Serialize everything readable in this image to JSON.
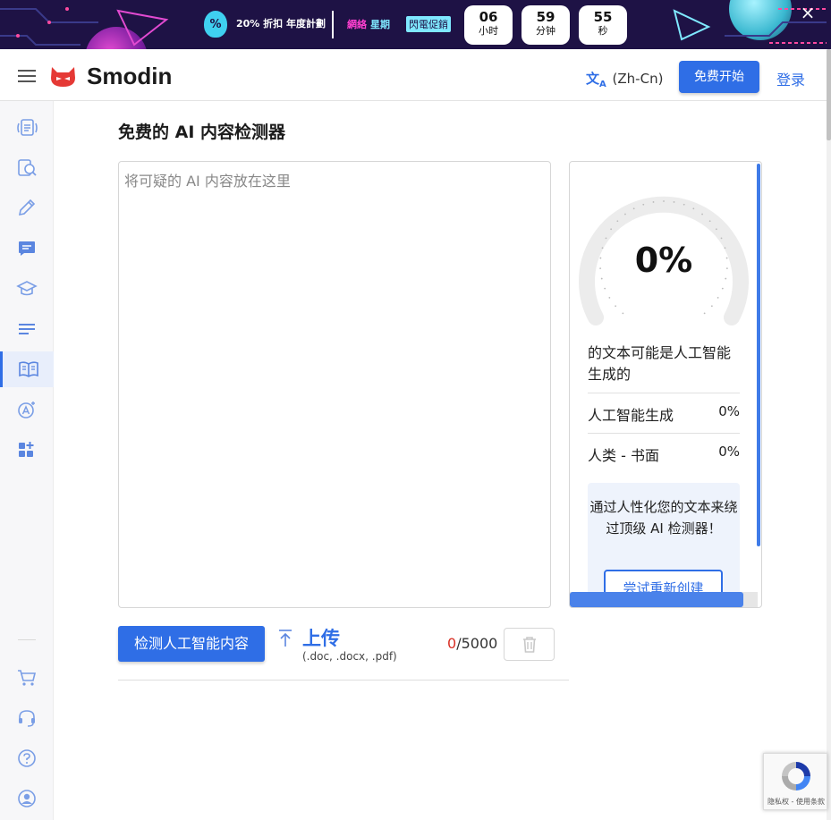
{
  "promo": {
    "offer": "20% 折扣 年度計劃",
    "cyber": "網絡",
    "week": "星期",
    "flash": "閃電促銷",
    "timers": [
      {
        "value": "06",
        "unit": "小时"
      },
      {
        "value": "59",
        "unit": "分钟"
      },
      {
        "value": "55",
        "unit": "秒"
      }
    ],
    "close_icon": "×"
  },
  "header": {
    "brand": "Smodin",
    "language": "(Zh-Cn)",
    "start_label": "免费开始",
    "login_label": "登录"
  },
  "sidebar": {
    "items": [
      {
        "name": "rewriter",
        "icon": "documents-icon"
      },
      {
        "name": "plagiarism",
        "icon": "search-doc-icon"
      },
      {
        "name": "writer",
        "icon": "pencil-icon"
      },
      {
        "name": "chat",
        "icon": "chat-icon"
      },
      {
        "name": "homework",
        "icon": "graduation-cap-icon"
      },
      {
        "name": "summarizer",
        "icon": "lines-icon"
      },
      {
        "name": "ai-detector",
        "icon": "book-icon",
        "active": true
      },
      {
        "name": "grader",
        "icon": "grade-a-icon"
      },
      {
        "name": "more",
        "icon": "apps-add-icon"
      }
    ],
    "bottom": [
      {
        "name": "cart",
        "icon": "cart-icon"
      },
      {
        "name": "support",
        "icon": "headset-icon"
      },
      {
        "name": "help",
        "icon": "help-icon"
      },
      {
        "name": "account",
        "icon": "user-circle-icon"
      }
    ]
  },
  "main": {
    "title": "免费的 AI 内容检测器",
    "input_placeholder": "将可疑的 AI 内容放在这里",
    "input_value": "",
    "detect_label": "检测人工智能内容",
    "upload_label": "上传",
    "upload_hint": "(.doc, .docx, .pdf)",
    "count_current": "0",
    "count_max": "/5000"
  },
  "result": {
    "percent": "0%",
    "percent_value": 0,
    "description": "的文本可能是人工智能生成的",
    "rows": [
      {
        "label": "人工智能生成",
        "value": "0%"
      },
      {
        "label": "人类 - 书面",
        "value": "0%"
      }
    ],
    "promo_text": "通过人性化您的文本来绕过顶级 AI 检测器！",
    "promo_button": "尝试重新创建"
  },
  "recaptcha": {
    "text": "隐私权 - 使用条款"
  },
  "colors": {
    "brand": "#2f6ee6",
    "banner": "#1e1245",
    "counter_red": "#d93025"
  }
}
